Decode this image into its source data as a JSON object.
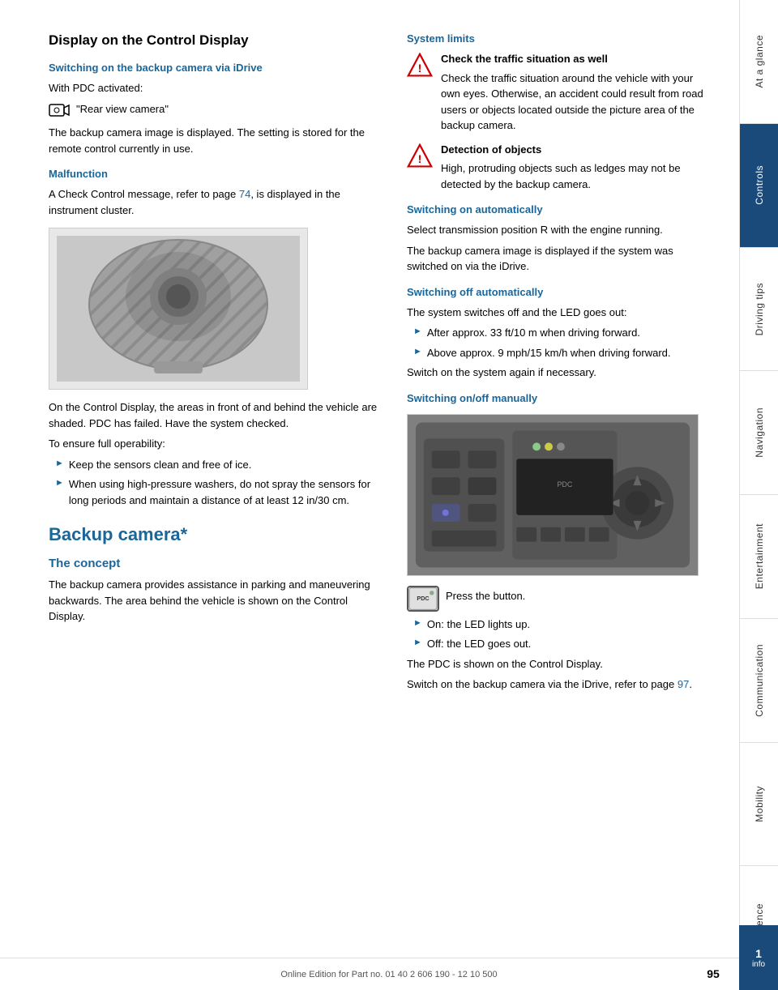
{
  "page": {
    "title": "Display on the Control Display",
    "page_number": "95",
    "footer_text": "Online Edition for Part no. 01 40 2 606 190 - 12 10 500"
  },
  "left_column": {
    "subsection1_heading": "Switching on the backup camera via iDrive",
    "subsection1_body1": "With PDC activated:",
    "subsection1_body2": "\"Rear view camera\"",
    "subsection1_body3": "The backup camera image is displayed. The setting is stored for the remote control currently in use.",
    "malfunction_heading": "Malfunction",
    "malfunction_body": "A Check Control message, refer to page 74, is displayed in the instrument cluster.",
    "malfunction_body2": "On the Control Display, the areas in front of and behind the vehicle are shaded. PDC has failed. Have the system checked.",
    "operability_heading": "To ensure full operability:",
    "bullet1": "Keep the sensors clean and free of ice.",
    "bullet2": "When using high-pressure washers, do not spray the sensors for long periods and maintain a distance of at least 12 in/30 cm.",
    "backup_camera_heading": "Backup camera*",
    "concept_heading": "The concept",
    "concept_body": "The backup camera provides assistance in parking and maneuvering backwards. The area behind the vehicle is shown on the Control Display."
  },
  "right_column": {
    "system_limits_heading": "System limits",
    "warning1_text1": "Check the traffic situation as well",
    "warning1_text2": "Check the traffic situation around the vehicle with your own eyes. Otherwise, an accident could result from road users or objects located outside the picture area of the backup camera.",
    "warning2_text1": "Detection of objects",
    "warning2_text2": "High, protruding objects such as ledges may not be detected by the backup camera.",
    "switching_on_heading": "Switching on automatically",
    "switching_on_body1": "Select transmission position R with the engine running.",
    "switching_on_body2": "The backup camera image is displayed if the system was switched on via the iDrive.",
    "switching_off_heading": "Switching off automatically",
    "switching_off_body": "The system switches off and the LED goes out:",
    "bullet_off1": "After approx. 33 ft/10 m when driving forward.",
    "bullet_off2": "Above approx. 9 mph/15 km/h when driving forward.",
    "switching_off_body2": "Switch on the system again if necessary.",
    "switching_manual_heading": "Switching on/off manually",
    "press_button_text": "Press the button.",
    "bullet_on_text": "On: the LED lights up.",
    "bullet_off_text": "Off: the LED goes out.",
    "pdc_text": "The PDC is shown on the Control Display.",
    "idrive_ref": "Switch on the backup camera via the iDrive, refer to page 97."
  },
  "sidebar": {
    "items": [
      {
        "label": "At a glance",
        "active": false
      },
      {
        "label": "Controls",
        "active": true
      },
      {
        "label": "Driving tips",
        "active": false
      },
      {
        "label": "Navigation",
        "active": false
      },
      {
        "label": "Entertainment",
        "active": false
      },
      {
        "label": "Communication",
        "active": false
      },
      {
        "label": "Mobility",
        "active": false
      },
      {
        "label": "Reference",
        "active": false
      }
    ]
  },
  "info_badge": {
    "number": "1",
    "label": "info"
  }
}
